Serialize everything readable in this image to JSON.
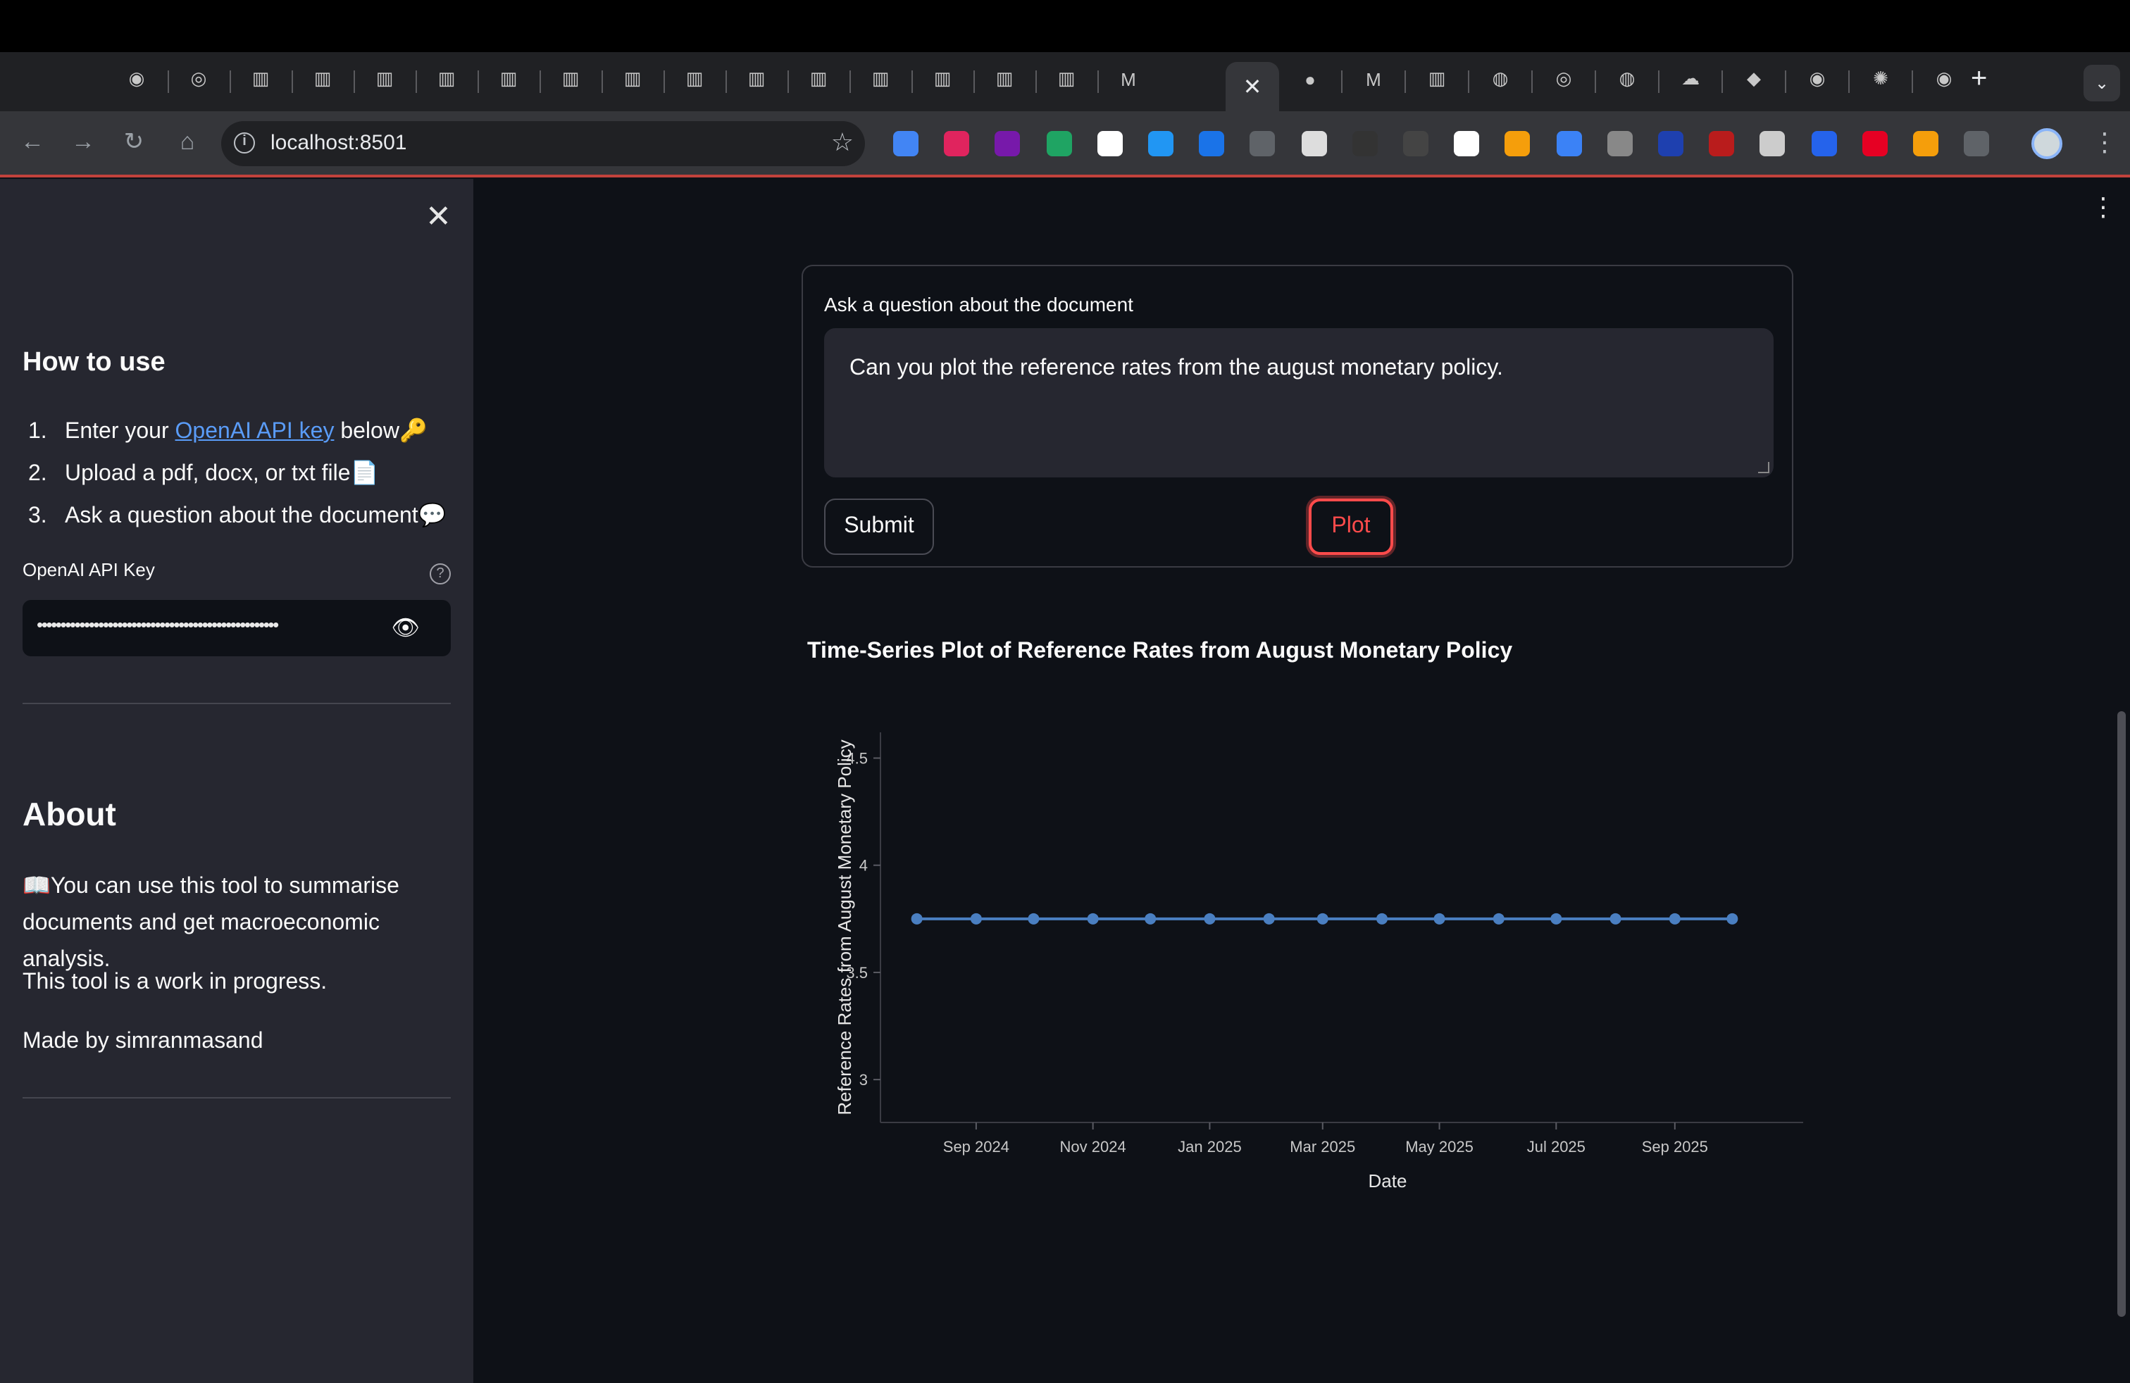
{
  "browser": {
    "url": "localhost:8501",
    "active_tab_close": "✕",
    "new_tab": "+",
    "tab_dropdown": "⌄",
    "tabs": [
      {
        "icon": "mask-icon"
      },
      {
        "icon": "globe-icon"
      },
      {
        "icon": "doc-icon"
      },
      {
        "icon": "doc-icon"
      },
      {
        "icon": "doc-icon"
      },
      {
        "icon": "doc-icon"
      },
      {
        "icon": "doc-icon"
      },
      {
        "icon": "doc-icon"
      },
      {
        "icon": "doc-icon"
      },
      {
        "icon": "doc-icon"
      },
      {
        "icon": "doc-icon"
      },
      {
        "icon": "doc-icon"
      },
      {
        "icon": "doc-icon"
      },
      {
        "icon": "doc-icon"
      },
      {
        "icon": "doc-icon"
      },
      {
        "icon": "doc-icon"
      },
      {
        "icon": "medium-icon",
        "label": "M"
      }
    ],
    "tabs_right": [
      {
        "icon": "github-icon"
      },
      {
        "icon": "medium-icon",
        "label": "M"
      },
      {
        "icon": "doc-icon"
      },
      {
        "icon": "stack-icon"
      },
      {
        "icon": "globe-icon"
      },
      {
        "icon": "stack-icon"
      },
      {
        "icon": "cloud-icon"
      },
      {
        "icon": "orange-icon"
      },
      {
        "icon": "mask-icon"
      },
      {
        "icon": "openai-icon"
      },
      {
        "icon": "mask-icon"
      }
    ]
  },
  "sidebar": {
    "heading": "How to use",
    "steps": [
      {
        "num": "1.",
        "pre": "Enter your ",
        "link": "OpenAI API key",
        "post": " below🔑"
      },
      {
        "num": "2.",
        "text": "Upload a pdf, docx, or txt file📄"
      },
      {
        "num": "3.",
        "text": "Ask a question about the document💬"
      }
    ],
    "api_label": "OpenAI API Key",
    "api_value": "•••••••••••••••••••••••••••••••••••••••••••••••••••",
    "about_heading": "About",
    "about_p1": "📖You can use this tool to summarise documents and get macroeconomic analysis.",
    "about_p2": "This tool is a work in progress.",
    "about_p3": "Made by simranmasand"
  },
  "form": {
    "label": "Ask a question about the document",
    "question": "Can you plot the reference rates from the august monetary policy.",
    "submit_label": "Submit",
    "plot_label": "Plot"
  },
  "chart_title": "Time-Series Plot of Reference Rates from August Monetary Policy",
  "chart_data": {
    "type": "line",
    "xlabel": "Date",
    "ylabel": "Reference Rates from August Monetary Policy",
    "x": [
      "2024-08-01",
      "2024-09-01",
      "2024-10-01",
      "2024-11-01",
      "2024-12-01",
      "2025-01-01",
      "2025-02-01",
      "2025-03-01",
      "2025-04-01",
      "2025-05-01",
      "2025-06-01",
      "2025-07-01",
      "2025-08-01",
      "2025-09-01",
      "2025-10-01"
    ],
    "y": [
      3.75,
      3.75,
      3.75,
      3.75,
      3.75,
      3.75,
      3.75,
      3.75,
      3.75,
      3.75,
      3.75,
      3.75,
      3.75,
      3.75,
      3.75
    ],
    "xticks": [
      "Sep 2024",
      "Nov 2024",
      "Jan 2025",
      "Mar 2025",
      "May 2025",
      "Jul 2025",
      "Sep 2025"
    ],
    "xtick_dates": [
      "2024-09-01",
      "2024-11-01",
      "2025-01-01",
      "2025-03-01",
      "2025-05-01",
      "2025-07-01",
      "2025-09-01"
    ],
    "yticks": [
      3,
      3.5,
      4,
      4.5
    ],
    "ytick_labels": [
      "3",
      "3.5",
      "4",
      "4.5"
    ],
    "ylim": [
      2.8,
      4.62
    ],
    "xlim": [
      "2024-07-13",
      "2025-10-27"
    ],
    "line_color": "#4a7fc1"
  }
}
